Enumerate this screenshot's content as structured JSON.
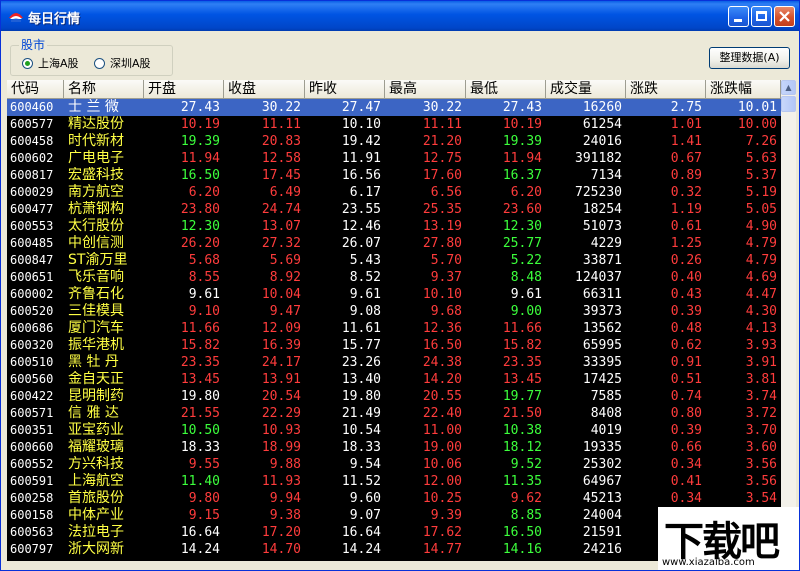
{
  "window": {
    "title": "每日行情"
  },
  "market_group": {
    "label": "股市",
    "options": [
      {
        "label": "上海A股",
        "selected": true
      },
      {
        "label": "深圳A股",
        "selected": false
      }
    ]
  },
  "toolbar": {
    "sort_button": "整理数据(A)"
  },
  "table": {
    "columns": [
      "代码",
      "名称",
      "开盘",
      "收盘",
      "昨收",
      "最高",
      "最低",
      "成交量",
      "涨跌",
      "涨跌幅"
    ],
    "rows": [
      [
        "600460",
        "士 兰 微",
        "27.43",
        "30.22",
        "27.47",
        "30.22",
        "27.43",
        "16260",
        "2.75",
        "10.01"
      ],
      [
        "600577",
        "精达股份",
        "10.19",
        "11.11",
        "10.10",
        "11.11",
        "10.19",
        "61254",
        "1.01",
        "10.00"
      ],
      [
        "600458",
        "时代新材",
        "19.39",
        "20.83",
        "19.42",
        "21.20",
        "19.39",
        "24016",
        "1.41",
        "7.26"
      ],
      [
        "600602",
        "广电电子",
        "11.94",
        "12.58",
        "11.91",
        "12.75",
        "11.94",
        "391182",
        "0.67",
        "5.63"
      ],
      [
        "600817",
        "宏盛科技",
        "16.50",
        "17.45",
        "16.56",
        "17.60",
        "16.37",
        "7134",
        "0.89",
        "5.37"
      ],
      [
        "600029",
        "南方航空",
        "6.20",
        "6.49",
        "6.17",
        "6.56",
        "6.20",
        "725230",
        "0.32",
        "5.19"
      ],
      [
        "600477",
        "杭萧钢构",
        "23.80",
        "24.74",
        "23.55",
        "25.35",
        "23.60",
        "18254",
        "1.19",
        "5.05"
      ],
      [
        "600553",
        "太行股份",
        "12.30",
        "13.07",
        "12.46",
        "13.19",
        "12.30",
        "51073",
        "0.61",
        "4.90"
      ],
      [
        "600485",
        "中创信测",
        "26.20",
        "27.32",
        "26.07",
        "27.80",
        "25.77",
        "4229",
        "1.25",
        "4.79"
      ],
      [
        "600847",
        "ST渝万里",
        "5.68",
        "5.69",
        "5.43",
        "5.70",
        "5.22",
        "33871",
        "0.26",
        "4.79"
      ],
      [
        "600651",
        "飞乐音响",
        "8.55",
        "8.92",
        "8.52",
        "9.37",
        "8.48",
        "124037",
        "0.40",
        "4.69"
      ],
      [
        "600002",
        "齐鲁石化",
        "9.61",
        "10.04",
        "9.61",
        "10.10",
        "9.61",
        "66311",
        "0.43",
        "4.47"
      ],
      [
        "600520",
        "三佳模具",
        "9.10",
        "9.47",
        "9.08",
        "9.68",
        "9.00",
        "39373",
        "0.39",
        "4.30"
      ],
      [
        "600686",
        "厦门汽车",
        "11.66",
        "12.09",
        "11.61",
        "12.36",
        "11.66",
        "13562",
        "0.48",
        "4.13"
      ],
      [
        "600320",
        "振华港机",
        "15.82",
        "16.39",
        "15.77",
        "16.50",
        "15.82",
        "65995",
        "0.62",
        "3.93"
      ],
      [
        "600510",
        "黑 牡 丹",
        "23.35",
        "24.17",
        "23.26",
        "24.38",
        "23.35",
        "33395",
        "0.91",
        "3.91"
      ],
      [
        "600560",
        "金自天正",
        "13.45",
        "13.91",
        "13.40",
        "14.20",
        "13.45",
        "17425",
        "0.51",
        "3.81"
      ],
      [
        "600422",
        "昆明制药",
        "19.80",
        "20.54",
        "19.80",
        "20.55",
        "19.77",
        "7585",
        "0.74",
        "3.74"
      ],
      [
        "600571",
        "信 雅 达",
        "21.55",
        "22.29",
        "21.49",
        "22.40",
        "21.50",
        "8408",
        "0.80",
        "3.72"
      ],
      [
        "600351",
        "亚宝药业",
        "10.50",
        "10.93",
        "10.54",
        "11.00",
        "10.38",
        "4019",
        "0.39",
        "3.70"
      ],
      [
        "600660",
        "福耀玻璃",
        "18.33",
        "18.99",
        "18.33",
        "19.00",
        "18.12",
        "19335",
        "0.66",
        "3.60"
      ],
      [
        "600552",
        "方兴科技",
        "9.55",
        "9.88",
        "9.54",
        "10.06",
        "9.52",
        "25302",
        "0.34",
        "3.56"
      ],
      [
        "600591",
        "上海航空",
        "11.40",
        "11.93",
        "11.52",
        "12.00",
        "11.35",
        "64967",
        "0.41",
        "3.56"
      ],
      [
        "600258",
        "首旅股份",
        "9.80",
        "9.94",
        "9.60",
        "10.25",
        "9.62",
        "45213",
        "0.34",
        "3.54"
      ],
      [
        "600158",
        "中体产业",
        "9.15",
        "9.38",
        "9.07",
        "9.39",
        "8.85",
        "24004",
        "",
        ""
      ],
      [
        "600563",
        "法拉电子",
        "16.64",
        "17.20",
        "16.64",
        "17.62",
        "16.50",
        "21591",
        "",
        ""
      ],
      [
        "600797",
        "浙大网新",
        "14.24",
        "14.70",
        "14.24",
        "14.77",
        "14.16",
        "24216",
        "",
        ""
      ]
    ],
    "selected_row": 0,
    "colors": {
      "up": "#ff3c3c",
      "down": "#3cff3c",
      "flat": "#ffffff",
      "code": "#ffffff",
      "name": "#ffff44"
    }
  },
  "watermark": {
    "logo": "下载吧",
    "url": "www.xiazaiba.com"
  }
}
